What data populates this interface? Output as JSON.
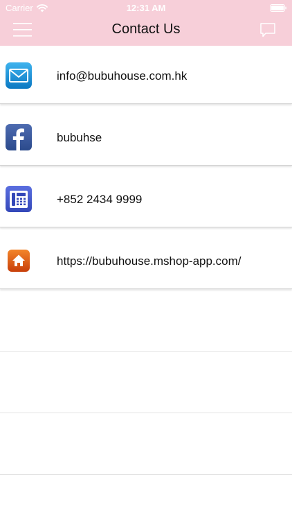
{
  "status_bar": {
    "carrier": "Carrier",
    "time": "12:31 AM"
  },
  "nav": {
    "title": "Contact Us",
    "left_icon": "menu-icon",
    "right_icon": "chat-icon",
    "background": "#f7cfd9"
  },
  "contacts": [
    {
      "icon": "email-icon",
      "text": "info@bubuhouse.com.hk"
    },
    {
      "icon": "facebook-icon",
      "text": "bubuhse"
    },
    {
      "icon": "phone-icon",
      "text": "+852 2434 9999"
    },
    {
      "icon": "home-icon",
      "text": "https://bubuhouse.mshop-app.com/"
    }
  ]
}
